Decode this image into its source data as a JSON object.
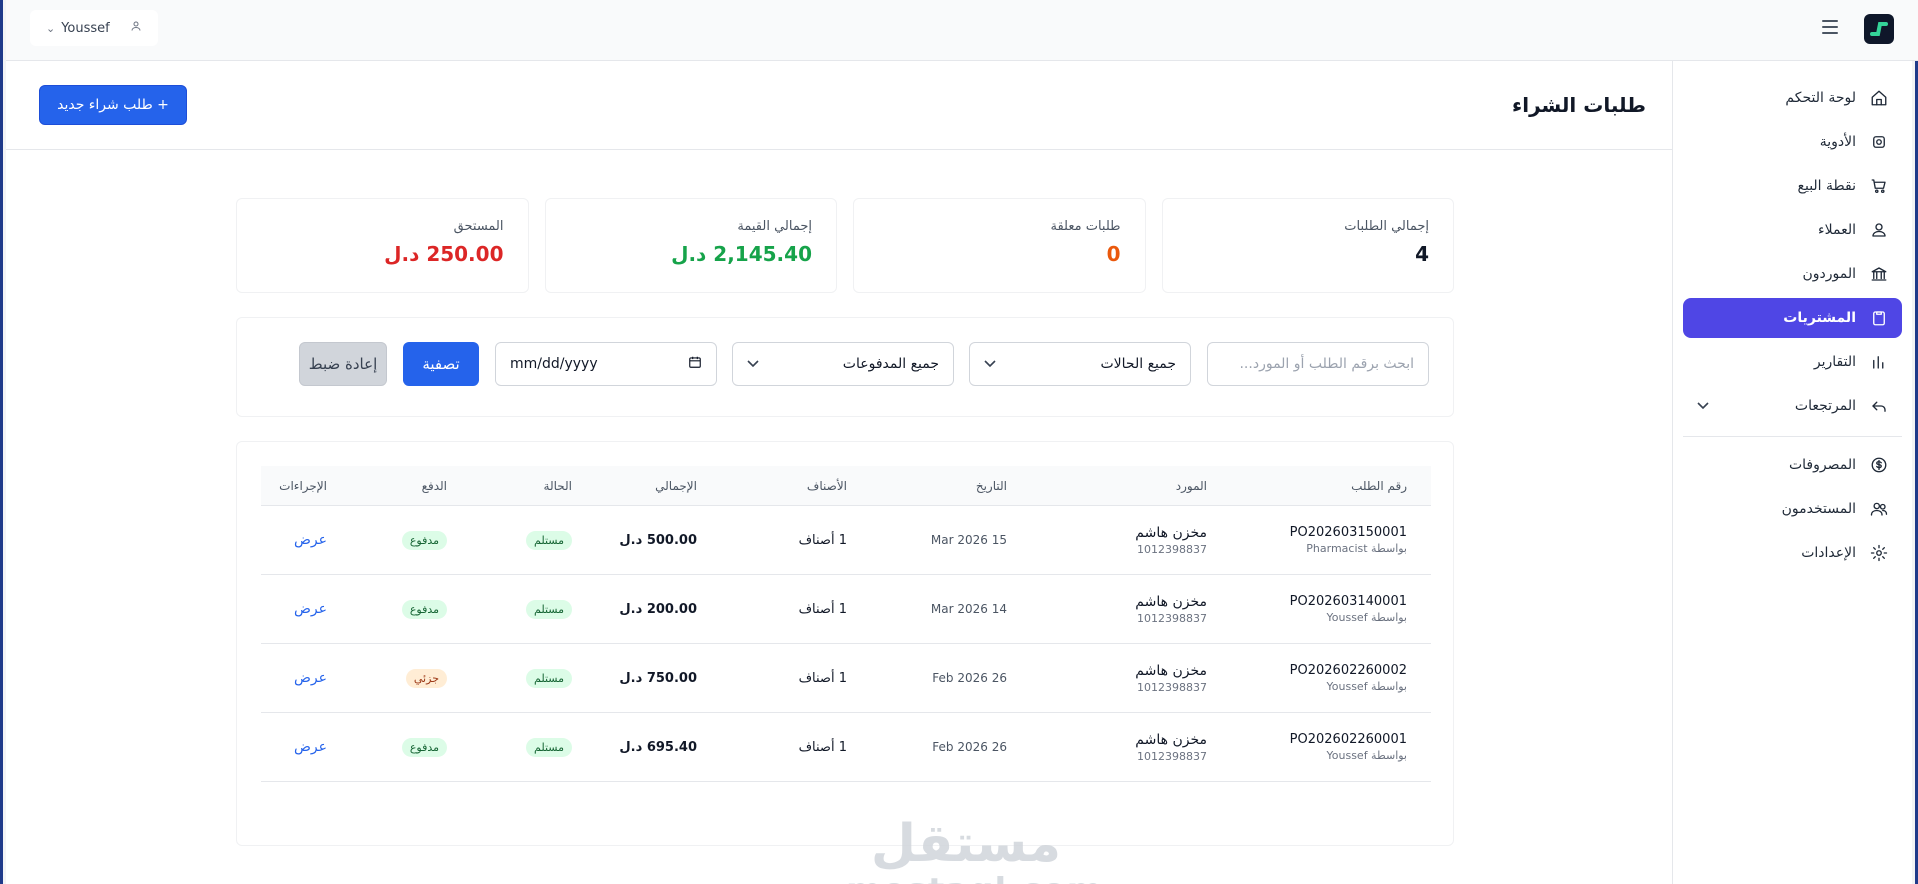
{
  "topbar": {
    "user_name": "Youssef"
  },
  "sidebar": {
    "items": [
      {
        "label": "لوحة التحكم",
        "icon": "home-icon"
      },
      {
        "label": "الأدوية",
        "icon": "pill-icon"
      },
      {
        "label": "نقطة البيع",
        "icon": "cart-icon"
      },
      {
        "label": "العملاء",
        "icon": "customers-icon"
      },
      {
        "label": "الموردون",
        "icon": "bank-icon"
      },
      {
        "label": "المشتريات",
        "icon": "clipboard-icon",
        "active": true
      },
      {
        "label": "التقارير",
        "icon": "chart-icon"
      },
      {
        "label": "المرتجعات",
        "icon": "return-icon",
        "has_submenu": true
      }
    ],
    "items_secondary": [
      {
        "label": "المصروفات",
        "icon": "dollar-icon"
      },
      {
        "label": "المستخدمون",
        "icon": "users-icon"
      },
      {
        "label": "الإعدادات",
        "icon": "gear-icon"
      }
    ],
    "active_color": "#4f46e5"
  },
  "header": {
    "title": "طلبات الشراء",
    "new_button": "+ طلب شراء جديد"
  },
  "stats": [
    {
      "label": "إجمالي الطلبات",
      "value": "4",
      "color": "#111827"
    },
    {
      "label": "طلبات معلقة",
      "value": "0",
      "color": "#ea580c"
    },
    {
      "label": "إجمالي القيمة",
      "value": "2,145.40 د.ل",
      "color": "#16a34a"
    },
    {
      "label": "المستحق",
      "value": "250.00 د.ل",
      "color": "#dc2626"
    }
  ],
  "filters": {
    "search_placeholder": "ابحث برقم الطلب أو المورد...",
    "status_value": "جميع الحالات",
    "payment_value": "جميع المدفوعات",
    "date_placeholder": "mm/dd/yyyy",
    "filter_button": "تصفية",
    "reset_button": "إعادة ضبط"
  },
  "table": {
    "columns": [
      "رقم الطلب",
      "المورد",
      "التاريخ",
      "الأصناف",
      "الإجمالي",
      "الحالة",
      "الدفع",
      "الإجراءات"
    ],
    "rows": [
      {
        "po": "PO202603150001",
        "by": "بواسطة Pharmacist",
        "supplier": "مخزن هاشم",
        "supplier_code": "1012398837",
        "date": "15 Mar 2026",
        "items": "1 أصناف",
        "total": "500.00 د.ل",
        "status": "مستلم",
        "payment": "مدفوع",
        "payment_type": "paid",
        "action": "عرض"
      },
      {
        "po": "PO202603140001",
        "by": "بواسطة Youssef",
        "supplier": "مخزن هاشم",
        "supplier_code": "1012398837",
        "date": "14 Mar 2026",
        "items": "1 أصناف",
        "total": "200.00 د.ل",
        "status": "مستلم",
        "payment": "مدفوع",
        "payment_type": "paid",
        "action": "عرض"
      },
      {
        "po": "PO202602260002",
        "by": "بواسطة Youssef",
        "supplier": "مخزن هاشم",
        "supplier_code": "1012398837",
        "date": "26 Feb 2026",
        "items": "1 أصناف",
        "total": "750.00 د.ل",
        "status": "مستلم",
        "payment": "جزئي",
        "payment_type": "partial",
        "action": "عرض"
      },
      {
        "po": "PO202602260001",
        "by": "بواسطة Youssef",
        "supplier": "مخزن هاشم",
        "supplier_code": "1012398837",
        "date": "26 Feb 2026",
        "items": "1 أصناف",
        "total": "695.40 د.ل",
        "status": "مستلم",
        "payment": "مدفوع",
        "payment_type": "paid",
        "action": "عرض"
      }
    ]
  },
  "watermark": {
    "arabic": "مستقل",
    "latin": "mostaql.com"
  }
}
